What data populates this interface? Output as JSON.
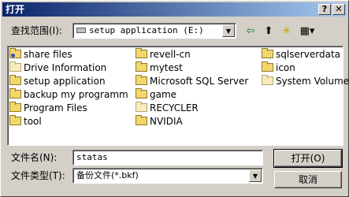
{
  "window": {
    "title": "打开",
    "help_label": "?",
    "close_label": "✕"
  },
  "look_in": {
    "label": "查找范围(I):",
    "value": "setup application (E:)"
  },
  "toolbar": {
    "back_icon": "⇦",
    "up_folder_icon": "⬆",
    "new_folder_icon": "✳",
    "view_menu_icon": "▦▾"
  },
  "files": [
    {
      "name": "share files",
      "kind": "share"
    },
    {
      "name": "Drive Information",
      "kind": "sys"
    },
    {
      "name": "setup application",
      "kind": "folder"
    },
    {
      "name": "backup my programm",
      "kind": "folder"
    },
    {
      "name": "Program Files",
      "kind": "folder"
    },
    {
      "name": "tool",
      "kind": "folder"
    },
    {
      "name": "revell-cn",
      "kind": "folder"
    },
    {
      "name": "mytest",
      "kind": "folder"
    },
    {
      "name": "Microsoft SQL Server",
      "kind": "folder"
    },
    {
      "name": "game",
      "kind": "folder"
    },
    {
      "name": "RECYCLER",
      "kind": "sys"
    },
    {
      "name": "NVIDIA",
      "kind": "folder"
    },
    {
      "name": "sqlserverdata",
      "kind": "folder"
    },
    {
      "name": "icon",
      "kind": "folder"
    },
    {
      "name": "System Volume I",
      "kind": "sys"
    }
  ],
  "file_name": {
    "label": "文件名(N):",
    "value": "statas"
  },
  "file_type": {
    "label": "文件类型(T):",
    "value": "备份文件(*.bkf)"
  },
  "buttons": {
    "open": "打开(O)",
    "cancel": "取消"
  }
}
